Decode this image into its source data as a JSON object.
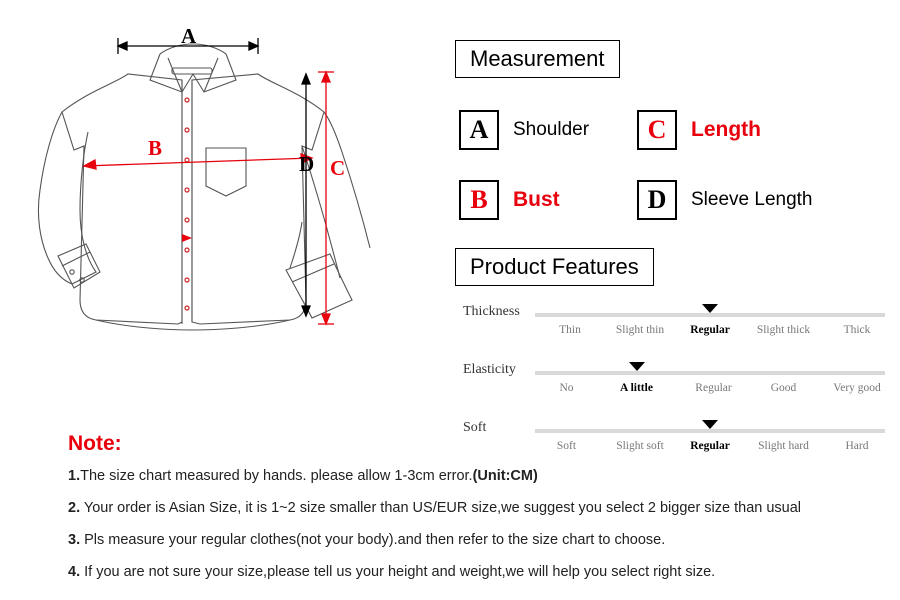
{
  "measurement": {
    "title": "Measurement",
    "items": [
      {
        "letter": "A",
        "letter_color": "black",
        "label": "Shoulder",
        "label_color": "black"
      },
      {
        "letter": "C",
        "letter_color": "red",
        "label": "Length",
        "label_color": "red"
      },
      {
        "letter": "B",
        "letter_color": "red",
        "label": "Bust",
        "label_color": "red"
      },
      {
        "letter": "D",
        "letter_color": "black",
        "label": "Sleeve Length",
        "label_color": "black"
      }
    ]
  },
  "features": {
    "title": "Product Features",
    "rows": [
      {
        "name": "Thickness",
        "ticks": [
          "Thin",
          "Slight thin",
          "Regular",
          "Slight thick",
          "Thick"
        ],
        "selected_index": 2
      },
      {
        "name": "Elasticity",
        "ticks": [
          "No",
          "A little",
          "Regular",
          "Good",
          "Very good"
        ],
        "selected_index": 1
      },
      {
        "name": "Soft",
        "ticks": [
          "Soft",
          "Slight soft",
          "Regular",
          "Slight hard",
          "Hard"
        ],
        "selected_index": 2
      }
    ]
  },
  "diagram": {
    "labels": [
      {
        "text": "A",
        "color": "black"
      },
      {
        "text": "B",
        "color": "red"
      },
      {
        "text": "C",
        "color": "red"
      },
      {
        "text": "D",
        "color": "black"
      }
    ]
  },
  "note": {
    "title": "Note:",
    "lines": [
      {
        "num": "1.",
        "text": "The size chart measured by hands.  please allow 1-3cm error.",
        "bold_tail": "(Unit:CM)"
      },
      {
        "num": "2.",
        "text": " Your order is Asian Size, it is 1~2 size smaller than US/EUR size,we suggest you select 2 bigger size than usual",
        "bold_tail": ""
      },
      {
        "num": "3.",
        "text": " Pls measure your regular clothes(not your body).and then refer to the size chart to choose.",
        "bold_tail": ""
      },
      {
        "num": "4.",
        "text": " If you are not sure your size,please tell us your height and weight,we will help you select right size.",
        "bold_tail": ""
      }
    ]
  },
  "colors": {
    "red": "#e8000d",
    "black": "#000000",
    "scale_track": "#d9d9d9",
    "tick_inactive": "#777777"
  }
}
